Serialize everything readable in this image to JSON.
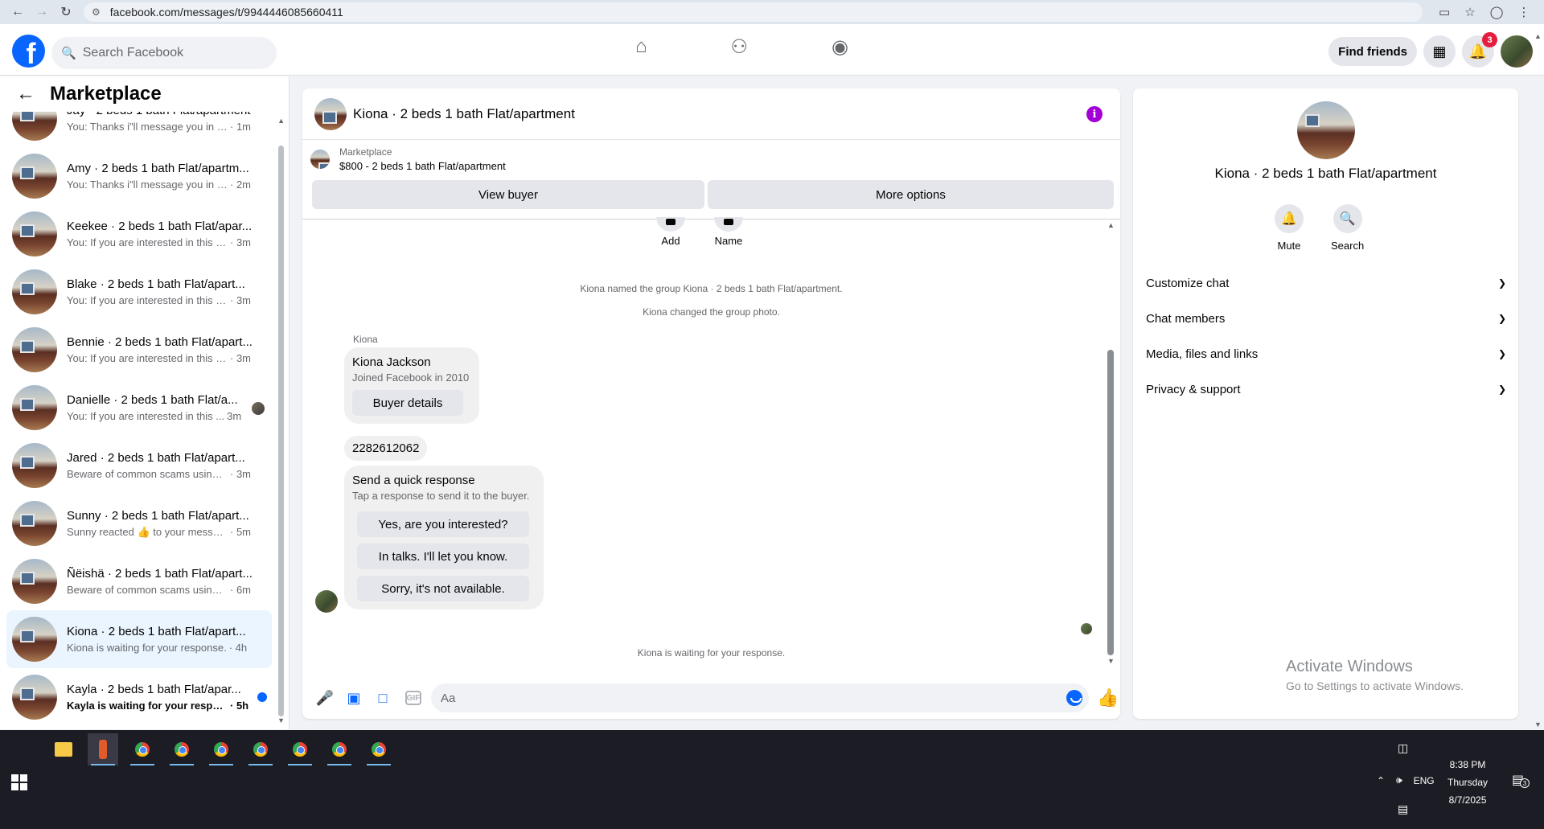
{
  "browser": {
    "url": "facebook.com/messages/t/9944446085660411"
  },
  "topbar": {
    "search_placeholder": "Search Facebook",
    "find_friends": "Find friends",
    "notif_count": "3"
  },
  "sidebar": {
    "title": "Marketplace",
    "conversations": [
      {
        "name": "Jay · 2 beds 1 bath Flat/apartment",
        "snippet": "You: Thanks i\"ll message you in a ...",
        "time": " · 1m"
      },
      {
        "name": "Amy · 2 beds 1 bath Flat/apartm...",
        "snippet": "You: Thanks i\"ll message you in a ...",
        "time": " · 2m"
      },
      {
        "name": "Keekee · 2 beds 1 bath Flat/apar...",
        "snippet": "You: If you are interested in this pl...",
        "time": " · 3m"
      },
      {
        "name": "Blake · 2 beds 1 bath Flat/apart...",
        "snippet": "You: If you are interested in this pl...",
        "time": " · 3m"
      },
      {
        "name": "Bennie · 2 beds 1 bath Flat/apart...",
        "snippet": "You: If you are interested in this pl...",
        "time": " · 3m"
      },
      {
        "name": "Danielle · 2 beds 1 bath Flat/a...",
        "snippet": "You: If you are interested in this ...",
        "time": " 3m"
      },
      {
        "name": "Jared · 2 beds 1 bath Flat/apart...",
        "snippet": "Beware of common scams using p...",
        "time": " · 3m"
      },
      {
        "name": "Sunny · 2 beds 1 bath Flat/apart...",
        "snippet": "Sunny reacted 👍 to your message",
        "time": " · 5m"
      },
      {
        "name": "Ñëishä · 2 beds 1 bath Flat/apart...",
        "snippet": "Beware of common scams using p...",
        "time": " · 6m"
      },
      {
        "name": "Kiona · 2 beds 1 bath Flat/apart...",
        "snippet": "Kiona is waiting for your response.",
        "time": " · 4h"
      },
      {
        "name": "Kayla · 2 beds 1 bath Flat/apar...",
        "snippet": "Kayla is waiting for your respon...",
        "time": " · 5h"
      }
    ]
  },
  "chat": {
    "title": "Kiona · 2 beds 1 bath Flat/apartment",
    "listing_label": "Marketplace",
    "listing_price": "$800 - 2 beds 1 bath Flat/apartment",
    "view_buyer": "View buyer",
    "more_options": "More options",
    "peek_add": "Add",
    "peek_name": "Name",
    "sys_named": "Kiona named the group Kiona · 2 beds 1 bath Flat/apartment.",
    "sys_photo": "Kiona changed the group photo.",
    "sender": "Kiona",
    "profile_name": "Kiona Jackson",
    "profile_joined": "Joined Facebook in 2010",
    "buyer_details": "Buyer details",
    "phone": "2282612062",
    "quick_title": "Send a quick response",
    "quick_sub": "Tap a response to send it to the buyer.",
    "quick_1": "Yes, are you interested?",
    "quick_2": "In talks. I'll let you know.",
    "quick_3": "Sorry, it's not available.",
    "waiting": "Kiona is waiting for your response.",
    "composer_placeholder": "Aa"
  },
  "info": {
    "title": "Kiona · 2 beds 1 bath Flat/apartment",
    "mute": "Mute",
    "search": "Search",
    "sections": [
      "Customize chat",
      "Chat members",
      "Media, files and links",
      "Privacy & support"
    ],
    "watermark_title": "Activate Windows",
    "watermark_sub": "Go to Settings to activate Windows."
  },
  "taskbar": {
    "lang": "ENG",
    "time": "8:38 PM",
    "day": "Thursday",
    "date": "8/7/2025",
    "notif_count": "3"
  },
  "colors": {
    "fb_blue": "#0866ff",
    "info_purple": "#a400d6",
    "badge_red": "#e41e3f"
  }
}
